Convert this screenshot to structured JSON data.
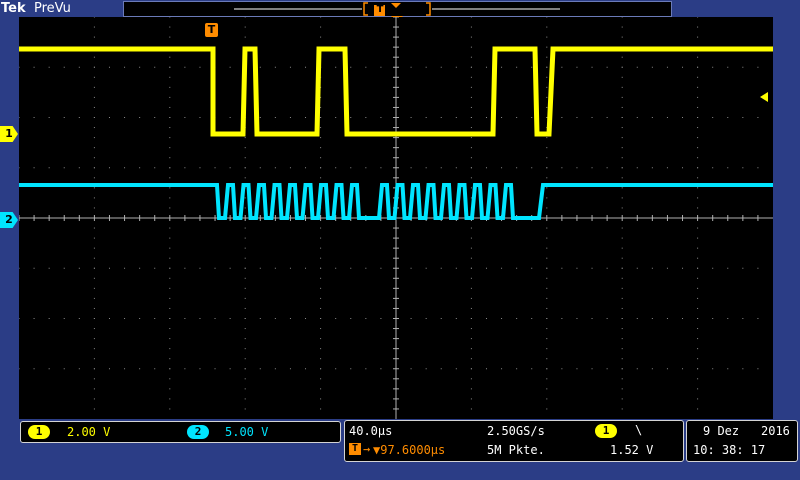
{
  "header": {
    "brand": "Tek",
    "mode": "PreVu",
    "trigger_marker": "T"
  },
  "colors": {
    "ch1": "#ffff00",
    "ch2": "#00e5ff",
    "trigger": "#ff8c00",
    "frame": "#2b3d86"
  },
  "screen_markers": {
    "trigger_flag": "T",
    "ch1_marker": "1",
    "ch2_marker": "2"
  },
  "channels": {
    "ch1": {
      "label": "1",
      "scale": "2.00 V"
    },
    "ch2": {
      "label": "2",
      "scale": "5.00 V"
    }
  },
  "acquisition": {
    "timebase": "40.0µs",
    "sample_rate": "2.50GS/s",
    "trigger_source": "1",
    "trigger_slope_icon": "falling-edge-icon",
    "trigger_slope_glyph": "\\",
    "trigger_position_label": "T",
    "trigger_position": "▼97.6000µs",
    "record_length": "5M Pkte.",
    "trigger_level": "1.52 V"
  },
  "datetime": {
    "date_day_month": "9 Dez",
    "year": "2016",
    "time": "10: 38: 17"
  }
}
